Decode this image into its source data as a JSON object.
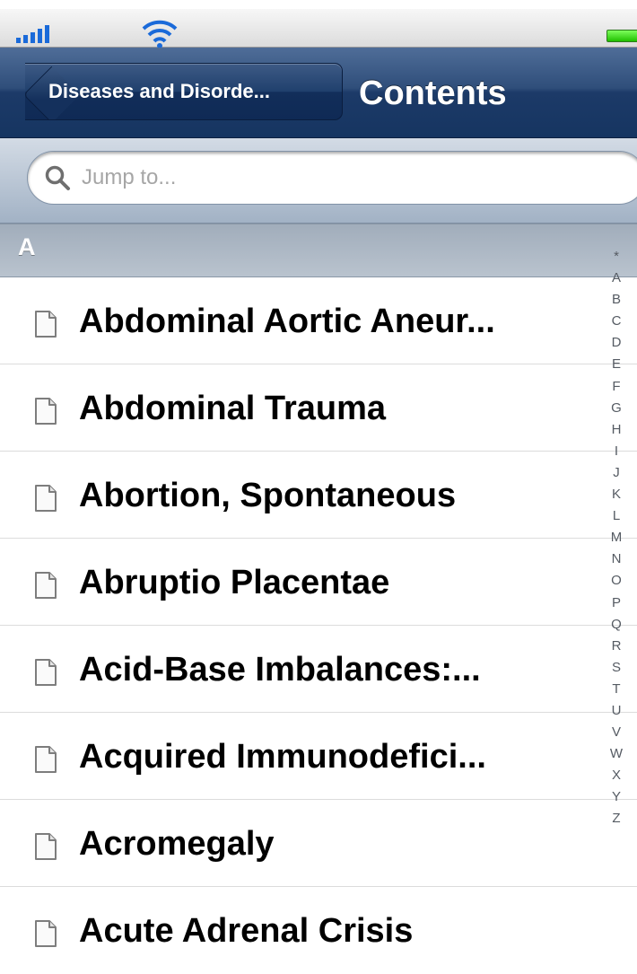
{
  "nav": {
    "back_label": "Diseases and Disorde...",
    "title": "Contents"
  },
  "search": {
    "placeholder": "Jump to..."
  },
  "section": {
    "title": "A"
  },
  "items": [
    {
      "label": "Abdominal Aortic Aneur..."
    },
    {
      "label": "Abdominal Trauma"
    },
    {
      "label": "Abortion, Spontaneous"
    },
    {
      "label": "Abruptio Placentae"
    },
    {
      "label": "Acid-Base Imbalances:..."
    },
    {
      "label": "Acquired Immunodefici..."
    },
    {
      "label": "Acromegaly"
    },
    {
      "label": "Acute Adrenal Crisis"
    }
  ],
  "index": [
    "*",
    "A",
    "B",
    "C",
    "D",
    "E",
    "F",
    "G",
    "H",
    "I",
    "J",
    "K",
    "L",
    "M",
    "N",
    "O",
    "P",
    "Q",
    "R",
    "S",
    "T",
    "U",
    "V",
    "W",
    "X",
    "Y",
    "Z"
  ],
  "icons": {
    "signal": "signal-icon",
    "wifi": "wifi-icon",
    "battery": "battery-icon",
    "search": "search-icon",
    "document": "document-icon"
  },
  "colors": {
    "nav_bar": "#2f4e7a",
    "section_header": "#a9b4c1",
    "battery": "#3fd32a"
  }
}
